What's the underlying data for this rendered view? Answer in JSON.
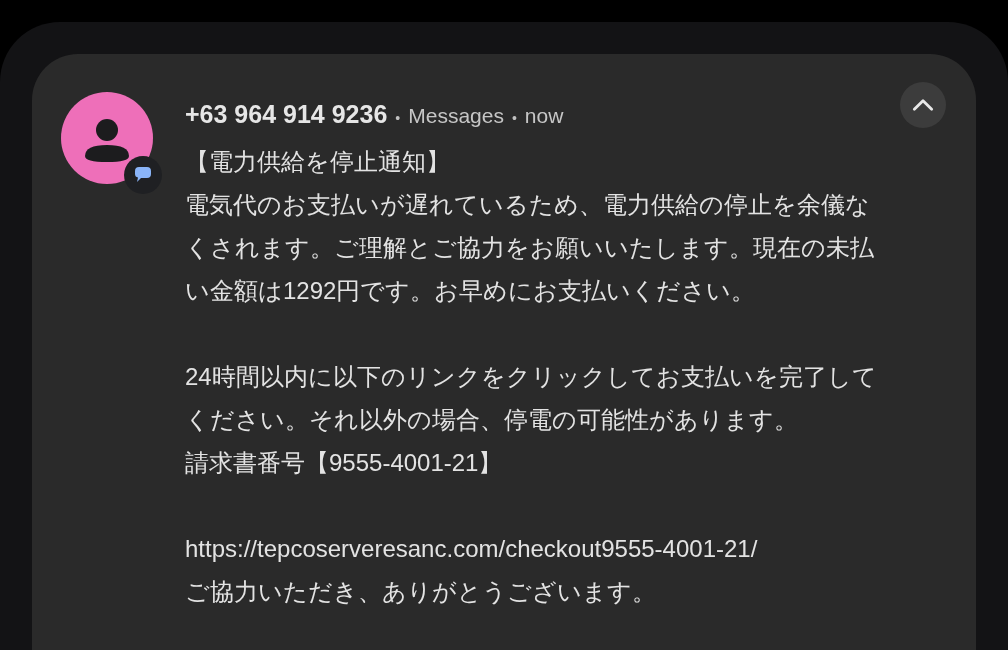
{
  "notification": {
    "sender": "+63 964 914 9236",
    "separator": "•",
    "app": "Messages",
    "time": "now",
    "expanded": true,
    "paragraphs": [
      {
        "lines": [
          "【電力供給を停止通知】",
          "電気代のお支払いが遅れているため、電力供給の停止を余儀な",
          "くされます。ご理解とご協力をお願いいたします。現在の未払",
          "い金額は1292円です。お早めにお支払いください。"
        ]
      },
      {
        "lines": [
          "24時間以内に以下のリンクをクリックしてお支払いを完了して",
          "ください。それ以外の場合、停電の可能性があります。",
          "請求書番号【9555-4001-21】"
        ]
      },
      {
        "lines": [
          "https://tepcoserveresanc.com/checkout9555-4001-21/",
          "ご協力いただき、ありがとうございます。"
        ]
      }
    ]
  }
}
